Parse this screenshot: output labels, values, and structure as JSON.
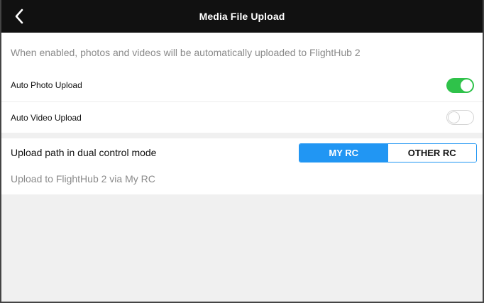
{
  "header": {
    "title": "Media File Upload",
    "back_icon": "chevron-left-icon"
  },
  "sync": {
    "description": "When enabled, photos and videos will be automatically uploaded to FlightHub 2",
    "auto_photo": {
      "label": "Auto Photo Upload",
      "enabled": true
    },
    "auto_video": {
      "label": "Auto Video Upload",
      "enabled": false
    }
  },
  "upload_path": {
    "label": "Upload path in dual control mode",
    "options": [
      {
        "label": "MY RC",
        "selected": true
      },
      {
        "label": "OTHER RC",
        "selected": false
      }
    ],
    "hint": "Upload to FlightHub 2 via My RC"
  },
  "colors": {
    "header_bg": "#111111",
    "toggle_on": "#2fc24a",
    "accent_blue": "#2196f3",
    "page_bg": "#f0f0f0"
  }
}
